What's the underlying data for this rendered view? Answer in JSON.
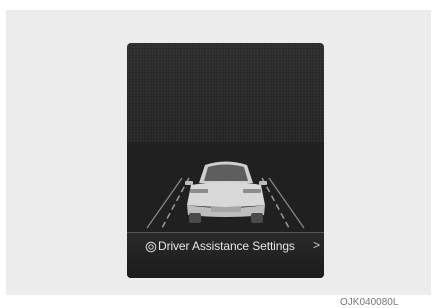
{
  "menu": {
    "settings_label": "Driver Assistance Settings",
    "settings_icon": "gear-icon",
    "chevron_icon": "chevron-right-icon",
    "chevron_glyph": ">"
  },
  "figure_code": "OJK040080L",
  "colors": {
    "screen_bg": "#242424",
    "panel_bg": "#ececec",
    "text": "#e6e6e6"
  }
}
